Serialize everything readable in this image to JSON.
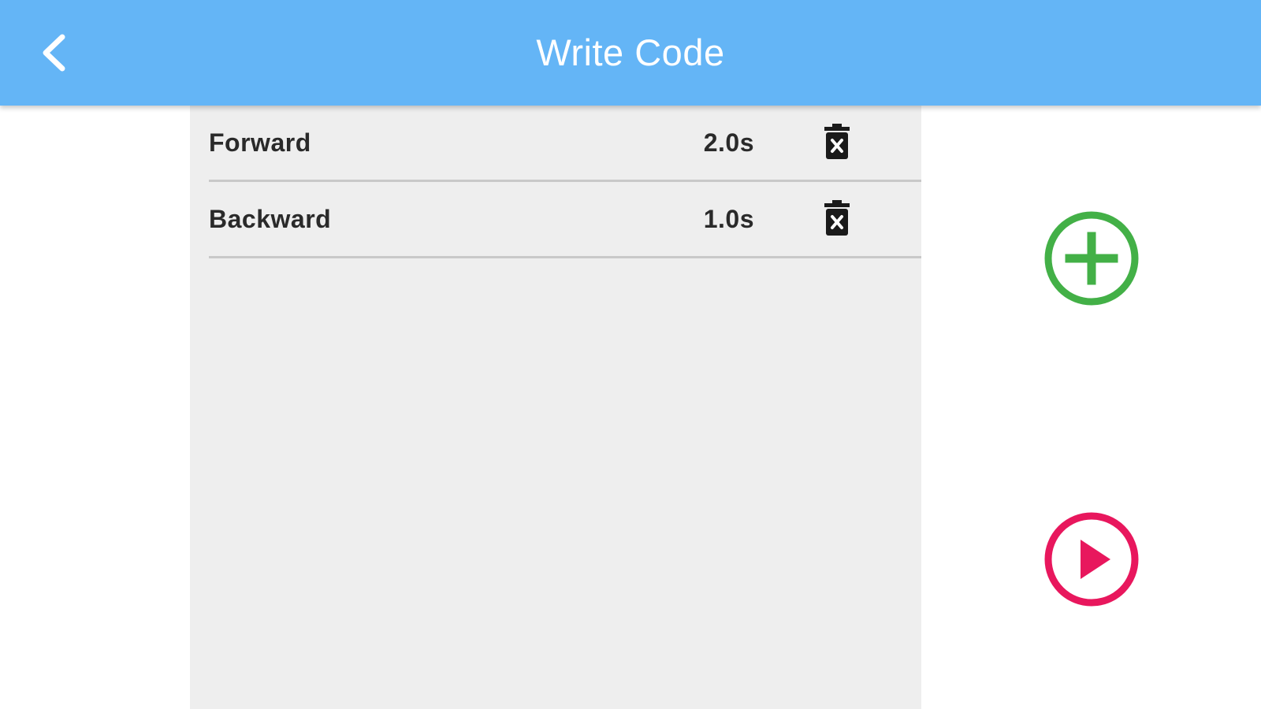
{
  "header": {
    "title": "Write Code",
    "back_icon": "chevron-left-icon",
    "background_color": "#64b5f6"
  },
  "commands": [
    {
      "label": "Forward",
      "duration": "2.0s",
      "delete_icon": "trash-x-icon"
    },
    {
      "label": "Backward",
      "duration": "1.0s",
      "delete_icon": "trash-x-icon"
    }
  ],
  "actions": {
    "add": {
      "icon": "plus-circle-icon",
      "color": "#43b047"
    },
    "run": {
      "icon": "play-circle-icon",
      "color": "#e8175d"
    }
  },
  "panel_color": "#eeeeee"
}
